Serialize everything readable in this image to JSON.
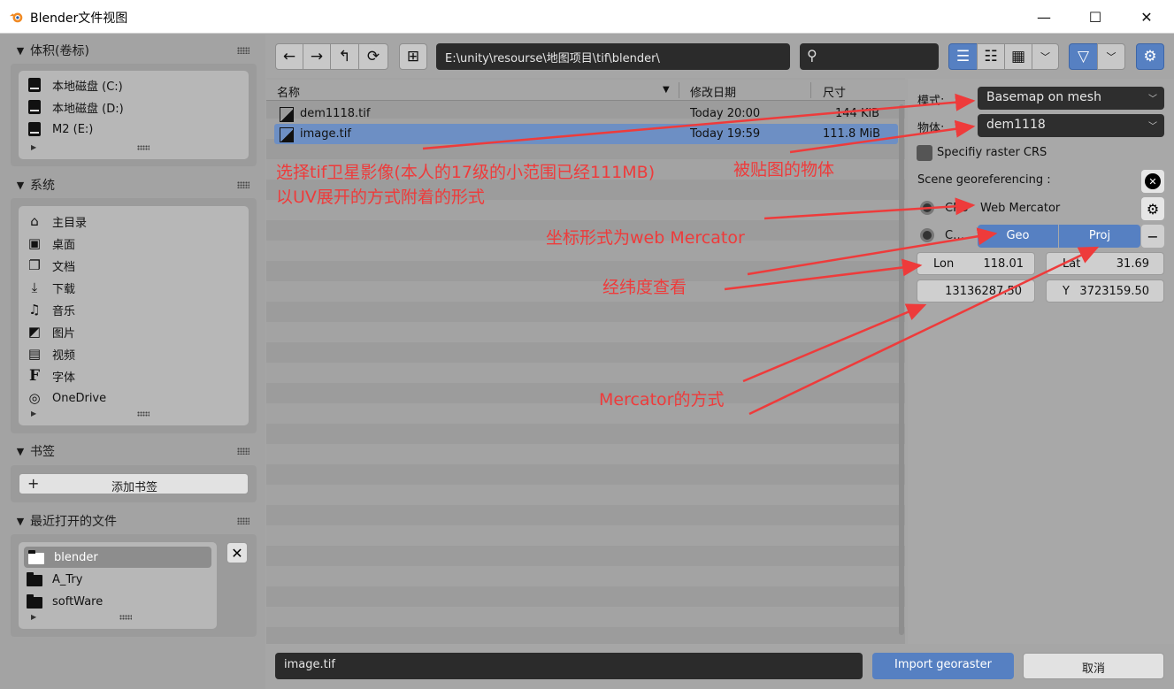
{
  "window": {
    "title": "Blender文件视图",
    "minimize": "—",
    "maximize": "☐",
    "close": "✕"
  },
  "sidebar": {
    "volumes": {
      "title": "体积(卷标)",
      "items": [
        "本地磁盘 (C:)",
        "本地磁盘 (D:)",
        "M2 (E:)"
      ]
    },
    "system": {
      "title": "系统",
      "items": [
        {
          "label": "主目录",
          "icon": "home-icon"
        },
        {
          "label": "桌面",
          "icon": "desktop-icon"
        },
        {
          "label": "文档",
          "icon": "documents-icon"
        },
        {
          "label": "下载",
          "icon": "download-icon"
        },
        {
          "label": "音乐",
          "icon": "music-icon"
        },
        {
          "label": "图片",
          "icon": "image-icon"
        },
        {
          "label": "视频",
          "icon": "video-icon"
        },
        {
          "label": "字体",
          "icon": "font-icon"
        },
        {
          "label": "OneDrive",
          "icon": "globe-icon"
        }
      ]
    },
    "bookmarks": {
      "title": "书签",
      "add_label": "添加书签"
    },
    "recent": {
      "title": "最近打开的文件",
      "items": [
        "blender",
        "A_Try",
        "softWare"
      ]
    }
  },
  "toolbar": {
    "path": "E:\\unity\\resourse\\地图项目\\tif\\blender\\",
    "search_placeholder": ""
  },
  "filelist": {
    "columns": {
      "name": "名称",
      "date": "修改日期",
      "size": "尺寸"
    },
    "rows": [
      {
        "name": "dem1118.tif",
        "date": "Today 20:00",
        "size": "144 KiB",
        "selected": false
      },
      {
        "name": "image.tif",
        "date": "Today 19:59",
        "size": "111.8 MiB",
        "selected": true
      }
    ]
  },
  "options": {
    "mode_label": "模式:",
    "mode_value": "Basemap on mesh",
    "object_label": "物体:",
    "object_value": "dem1118",
    "specify_crs": "Specifiy raster CRS",
    "scene_georef": "Scene georeferencing :",
    "crs_label": "CRS",
    "crs_value": "Web Mercator",
    "geo_tab": "Geo",
    "proj_tab": "Proj",
    "lon_label": "Lon",
    "lon_value": "118.01",
    "lat_label": "Lat",
    "lat_value": "31.69",
    "x_value": "13136287.50",
    "y_label": "Y",
    "y_value": "3723159.50"
  },
  "footer": {
    "filename": "image.tif",
    "import_label": "Import georaster",
    "cancel_label": "取消"
  },
  "annotations": {
    "a1_line1": "选择tif卫星影像(本人的17级的小范围已经111MB)",
    "a1_line2": "以UV展开的方式附着的形式",
    "a2": "被贴图的物体",
    "a3": "坐标形式为web Mercator",
    "a4": "经纬度查看",
    "a5": "Mercator的方式"
  },
  "colors": {
    "accent": "#5680c2",
    "selected_row": "#6d8fc4",
    "annotation": "#ee3b3b"
  }
}
